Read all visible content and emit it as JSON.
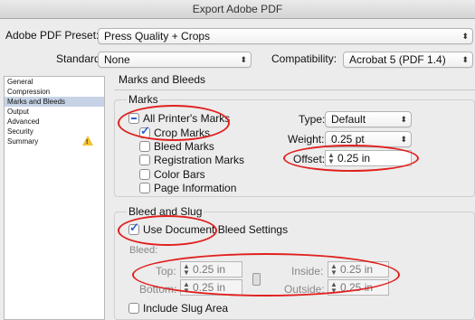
{
  "window": {
    "title": "Export Adobe PDF"
  },
  "preset": {
    "label": "Adobe PDF Preset:",
    "value": "Press Quality + Crops"
  },
  "standard": {
    "label": "Standard:",
    "value": "None"
  },
  "compatibility": {
    "label": "Compatibility:",
    "value": "Acrobat 5 (PDF 1.4)"
  },
  "sidebar": {
    "items": [
      {
        "label": "General"
      },
      {
        "label": "Compression"
      },
      {
        "label": "Marks and Bleeds"
      },
      {
        "label": "Output"
      },
      {
        "label": "Advanced"
      },
      {
        "label": "Security"
      },
      {
        "label": "Summary"
      }
    ],
    "selected_index": 2
  },
  "section": {
    "title": "Marks and Bleeds"
  },
  "marks": {
    "group_label": "Marks",
    "all_printers_marks": "All Printer's Marks",
    "crop_marks": "Crop Marks",
    "bleed_marks": "Bleed Marks",
    "registration_marks": "Registration Marks",
    "color_bars": "Color Bars",
    "page_information": "Page Information",
    "type_label": "Type:",
    "type_value": "Default",
    "weight_label": "Weight:",
    "weight_value": "0.25 pt",
    "offset_label": "Offset:",
    "offset_value": "0.25 in"
  },
  "bleed": {
    "group_label": "Bleed and Slug",
    "use_document": "Use Document Bleed Settings",
    "bleed_label": "Bleed:",
    "top_label": "Top:",
    "top_value": "0.25 in",
    "bottom_label": "Bottom:",
    "bottom_value": "0.25 in",
    "inside_label": "Inside:",
    "inside_value": "0.25 in",
    "outside_label": "Outside:",
    "outside_value": "0.25 in",
    "include_slug": "Include Slug Area"
  },
  "colors": {
    "annotation": "#e0201f",
    "selection": "#c6d3e6",
    "check": "#2b63c8"
  },
  "icons": {
    "warning": "warning-icon",
    "link": "link-chain-icon",
    "select_arrows": "chevron-updown-icon"
  }
}
